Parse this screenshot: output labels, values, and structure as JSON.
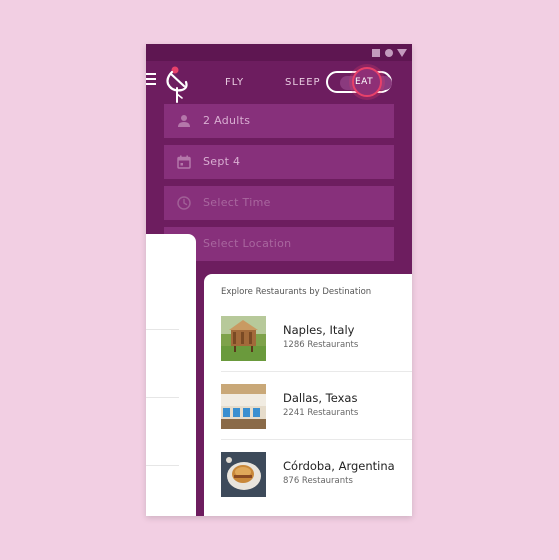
{
  "status_bar": {
    "icons": [
      "square-icon",
      "circle-icon",
      "triangle-icon"
    ]
  },
  "header": {
    "tabs": [
      {
        "label": "FLY"
      },
      {
        "label": "SLEEP"
      }
    ],
    "toggle": {
      "label": "EAT",
      "active": true
    }
  },
  "form": {
    "fields": [
      {
        "icon": "person-icon",
        "value": "2 Adults",
        "placeholder": ""
      },
      {
        "icon": "calendar-icon",
        "value": "Sept 4",
        "placeholder": ""
      },
      {
        "icon": "clock-icon",
        "value": "",
        "placeholder": "Select Time"
      },
      {
        "icon": "location-icon",
        "value": "",
        "placeholder": "Select Location"
      }
    ]
  },
  "explore": {
    "title": "Explore Restaurants by Destination",
    "destinations": [
      {
        "name": "Naples, Italy",
        "count": "1286 Restaurants"
      },
      {
        "name": "Dallas, Texas",
        "count": "2241 Restaurants"
      },
      {
        "name": "Córdoba, Argentina",
        "count": "876 Restaurants"
      }
    ]
  },
  "colors": {
    "background": "#f2cfe3",
    "app_bg": "#6d1d5f",
    "field_bg": "#87307b",
    "accent": "#e8416a"
  }
}
